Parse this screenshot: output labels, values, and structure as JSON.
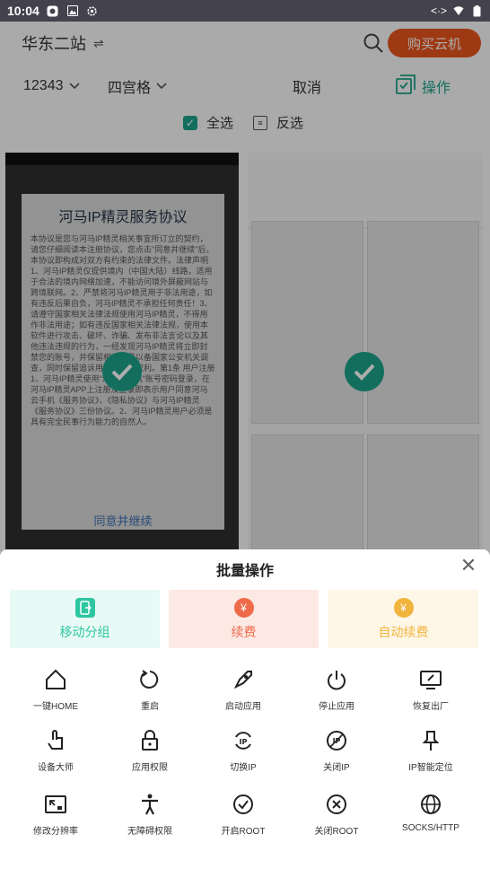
{
  "status_bar": {
    "time": "10:04"
  },
  "header": {
    "site_name": "华东二站",
    "buy_label": "购买云机"
  },
  "filters": {
    "group": "12343",
    "layout": "四宫格",
    "cancel": "取消",
    "operate": "操作"
  },
  "selection": {
    "select_all": "全选",
    "invert": "反选"
  },
  "device1": {
    "dialog_title": "河马IP精灵服务协议",
    "dialog_text": "本协议是您与河马IP精灵相关事宜所订立的契约，请您仔细阅读本注册协议，您点击\"同意并继续\"后，本协议即构成对双方有约束的法律文件。法律声明 1、河马IP精灵仅提供境内（中国大陆）线路，适用于合法的境内网络加速，不能访问境外屏蔽网站与跨境联网。2、严禁将河马IP精灵用于非法用途，如有违反后果自负，河马IP精灵不承担任何责任！3、请遵守国家相关法律法规使用河马IP精灵，不得用作非法用途；如有违反国家相关法律法规，使用本软件进行攻击、破坏、诈骗、发布非法言论以及其他违法违规的行为，一经发现河马IP精灵将立即封禁您的账号，并保留相关记录以备国家公安机关调查，同时保留追诉用户权责的权利。第1条 用户注册 1、河马IP精灵使用\"河马云手机\"账号密码登录，在河马IP精灵APP上注册及登录即表示用户同意河马云手机《服务协议》、《隐私协议》与河马IP精灵《服务协议》三份协议。2、河马IP精灵用户必须是具有完全民事行为能力的自然人。",
    "dialog_button": "同意并继续"
  },
  "sheet": {
    "title": "批量操作",
    "primary_actions": [
      {
        "label": "移动分组",
        "color": "#2fc6a2",
        "bg": "#e8faf5"
      },
      {
        "label": "续费",
        "color": "#ef6a4a",
        "bg": "#fde9e4"
      },
      {
        "label": "自动续费",
        "color": "#f1b43c",
        "bg": "#fef6e6"
      }
    ],
    "grid": [
      {
        "label": "一键HOME",
        "icon": "home-icon"
      },
      {
        "label": "重启",
        "icon": "restart-icon"
      },
      {
        "label": "启动应用",
        "icon": "rocket-icon"
      },
      {
        "label": "停止应用",
        "icon": "power-icon"
      },
      {
        "label": "恢复出厂",
        "icon": "factory-reset-icon"
      },
      {
        "label": "设备大师",
        "icon": "touch-icon"
      },
      {
        "label": "应用权限",
        "icon": "lock-icon"
      },
      {
        "label": "切换IP",
        "icon": "switch-ip-icon"
      },
      {
        "label": "关闭IP",
        "icon": "close-ip-icon"
      },
      {
        "label": "IP智能定位",
        "icon": "pin-icon"
      },
      {
        "label": "修改分辨率",
        "icon": "resolution-icon"
      },
      {
        "label": "无障碍权限",
        "icon": "accessibility-icon"
      },
      {
        "label": "开启ROOT",
        "icon": "check-circle-icon"
      },
      {
        "label": "关闭ROOT",
        "icon": "x-circle-icon"
      },
      {
        "label": "SOCKS/HTTP",
        "icon": "globe-icon"
      }
    ]
  }
}
